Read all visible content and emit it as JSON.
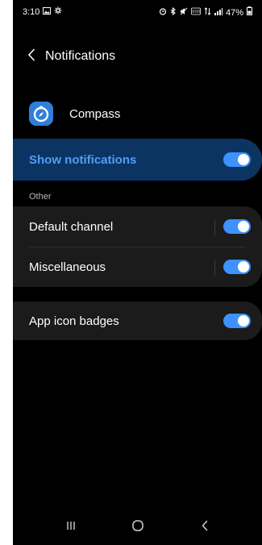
{
  "status_bar": {
    "time": "3:10",
    "battery": "47%"
  },
  "header": {
    "title": "Notifications",
    "back_icon": "chevron-left-icon"
  },
  "app": {
    "name": "Compass",
    "icon": "compass-icon",
    "icon_color": "#2e7fd9"
  },
  "show_notifications": {
    "label": "Show notifications",
    "enabled": true
  },
  "section": {
    "label": "Other"
  },
  "channels": [
    {
      "label": "Default channel",
      "enabled": true
    },
    {
      "label": "Miscellaneous",
      "enabled": true
    }
  ],
  "badges": {
    "label": "App icon badges",
    "enabled": true
  },
  "nav": {
    "recents_icon": "recents-icon",
    "home_icon": "home-icon",
    "back_icon": "back-icon"
  },
  "colors": {
    "accent": "#3e91ff",
    "highlight_card": "#0c3463",
    "highlight_text": "#4f9ef7",
    "card": "#1b1b1b",
    "background": "#000000"
  }
}
